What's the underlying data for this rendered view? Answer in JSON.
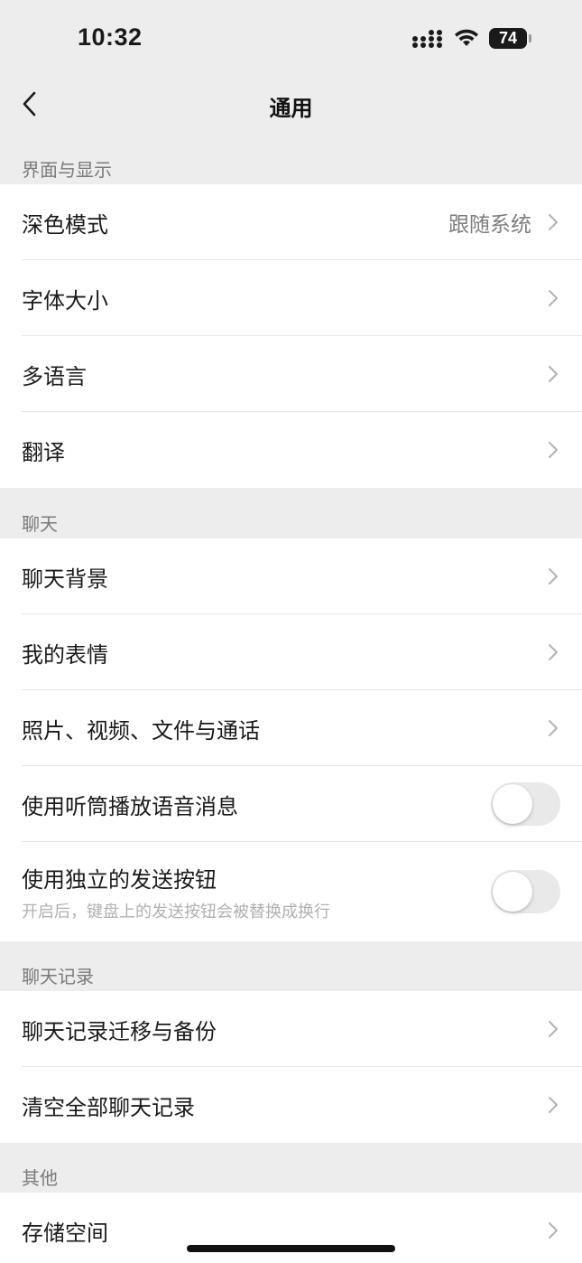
{
  "status_bar": {
    "time": "10:32",
    "battery": "74"
  },
  "nav": {
    "title": "通用"
  },
  "sections": {
    "display": {
      "header": "界面与显示",
      "dark_mode": {
        "label": "深色模式",
        "value": "跟随系统"
      },
      "font_size": {
        "label": "字体大小"
      },
      "language": {
        "label": "多语言"
      },
      "translate": {
        "label": "翻译"
      }
    },
    "chat": {
      "header": "聊天",
      "background": {
        "label": "聊天背景"
      },
      "stickers": {
        "label": "我的表情"
      },
      "media": {
        "label": "照片、视频、文件与通话"
      },
      "earpiece": {
        "label": "使用听筒播放语音消息",
        "enabled": false
      },
      "send_button": {
        "label": "使用独立的发送按钮",
        "description": "开启后，键盘上的发送按钮会被替换成换行",
        "enabled": false
      }
    },
    "history": {
      "header": "聊天记录",
      "migrate": {
        "label": "聊天记录迁移与备份"
      },
      "clear": {
        "label": "清空全部聊天记录"
      }
    },
    "other": {
      "header": "其他",
      "storage": {
        "label": "存储空间"
      }
    }
  },
  "colors": {
    "background": "#ededed",
    "card": "#ffffff",
    "toggle_off": "#e9e9ea"
  }
}
